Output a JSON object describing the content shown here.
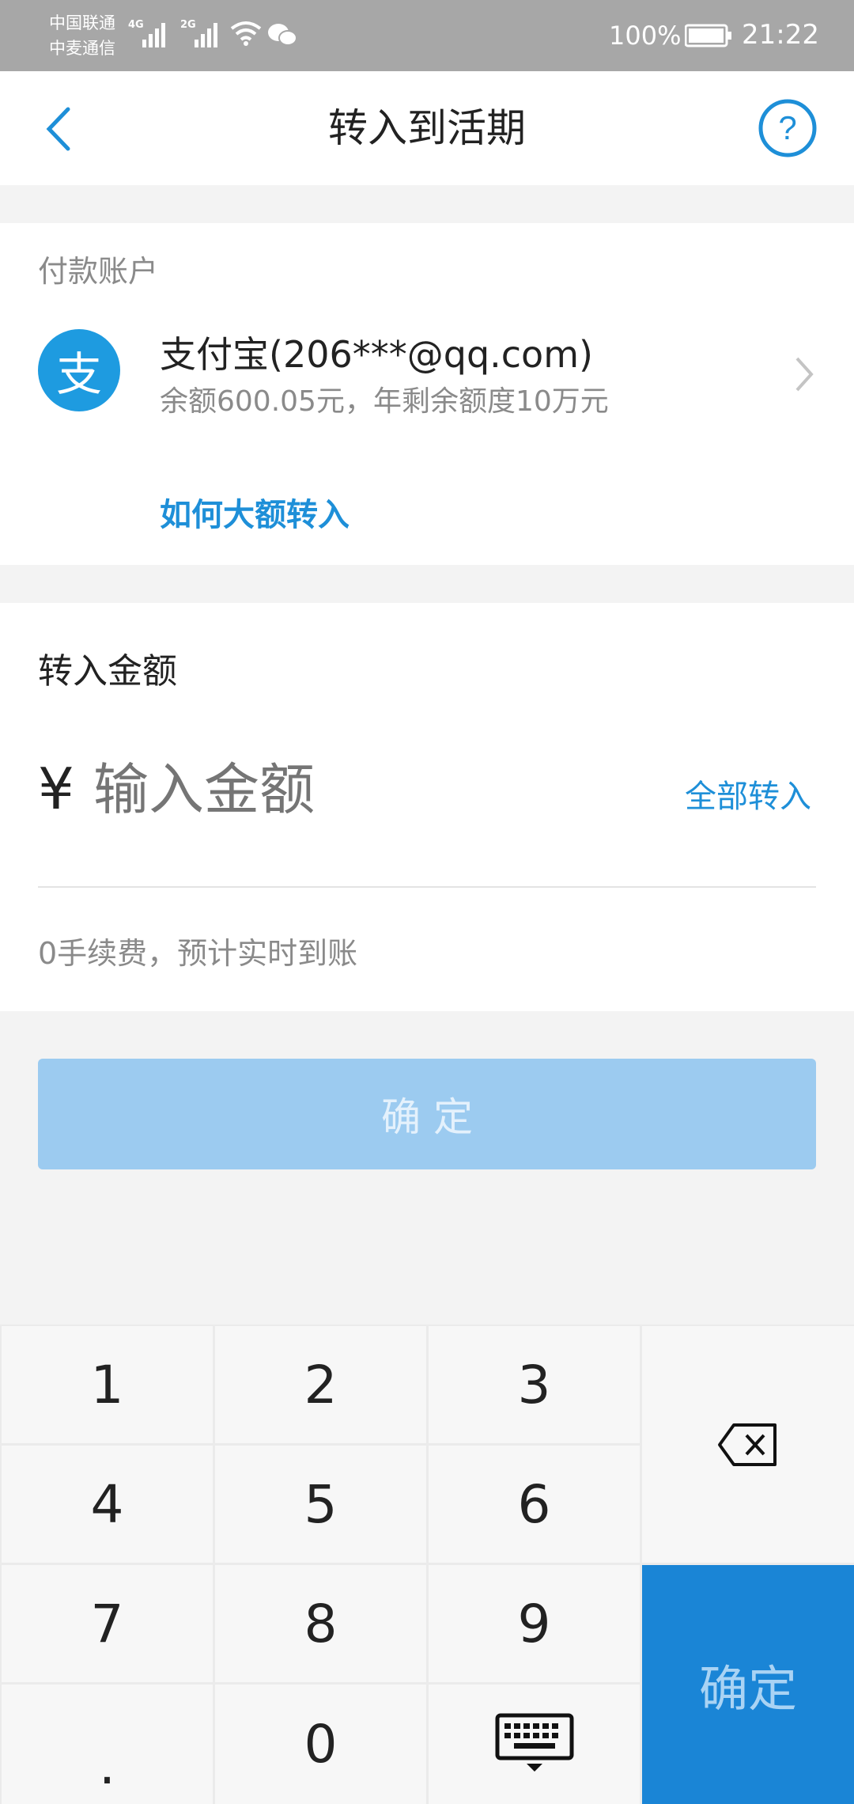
{
  "status_bar": {
    "carrier1": "中国联通",
    "carrier2": "中麦通信",
    "net1": "4G",
    "net2": "2G",
    "battery": "100%",
    "time": "21:22"
  },
  "header": {
    "title": "转入到活期",
    "back_icon": "chevron-left-icon",
    "help_icon": "question-circle-icon"
  },
  "account": {
    "section_label": "付款账户",
    "name": "支付宝(206***@qq.com)",
    "balance_info": "余额600.05元，年剩余额度10万元",
    "large_transfer_link": "如何大额转入",
    "logo_glyph": "支"
  },
  "amount": {
    "section_label": "转入金额",
    "currency": "¥",
    "placeholder": "输入金额",
    "transfer_all": "全部转入",
    "fee_note": "0手续费，预计实时到账"
  },
  "confirm_button": "确 定",
  "keypad": {
    "k1": "1",
    "k2": "2",
    "k3": "3",
    "k4": "4",
    "k5": "5",
    "k6": "6",
    "k7": "7",
    "k8": "8",
    "k9": "9",
    "dot": ".",
    "k0": "0",
    "confirm": "确定"
  },
  "colors": {
    "accent": "#1e8fd8",
    "confirm_disabled": "#9ccbf0",
    "keypad_confirm": "#1a85d6"
  }
}
